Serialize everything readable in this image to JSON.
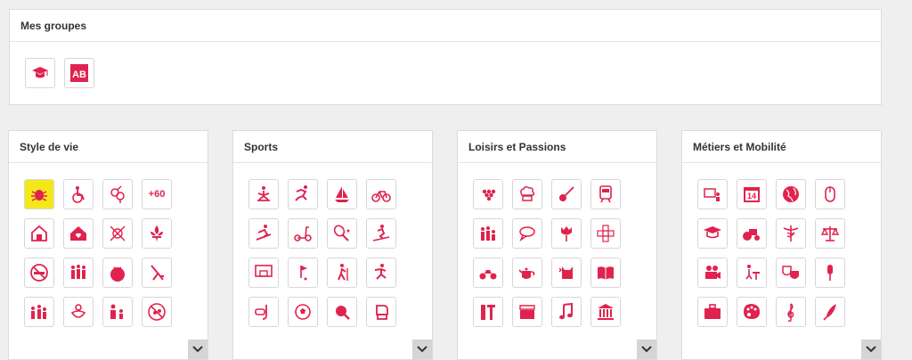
{
  "groups": {
    "title": "Mes groupes",
    "icons": [
      "graduation-cap-icon",
      "ab-letters-icon"
    ]
  },
  "categories": [
    {
      "title": "Style de vie",
      "icons": [
        "bug-icon",
        "wheelchair-icon",
        "gender-symbols-icon",
        "plus-60-icon",
        "house-icon",
        "house-heart-icon",
        "no-gender-icon",
        "fleur-de-lis-icon",
        "no-smoking-icon",
        "family-group-icon",
        "tomato-icon",
        "deck-chair-icon",
        "family-icon",
        "baby-pacifier-icon",
        "parent-child-icon",
        "no-pets-icon"
      ],
      "labels": {
        "plus-60-icon": "+60"
      }
    },
    {
      "title": "Sports",
      "icons": [
        "yoga-icon",
        "running-icon",
        "sailboat-icon",
        "bicycle-icon",
        "snowboard-icon",
        "scooter-icon",
        "tennis-icon",
        "ski-icon",
        "basketball-icon",
        "golf-icon",
        "hiking-icon",
        "ice-skating-icon",
        "snorkel-icon",
        "soccer-ball-icon",
        "ping-pong-icon",
        "boxing-glove-icon"
      ]
    },
    {
      "title": "Loisirs et Passions",
      "icons": [
        "grapes-icon",
        "chef-hat-icon",
        "guitar-icon",
        "train-icon",
        "family-walk-icon",
        "speech-bubble-icon",
        "tulip-icon",
        "crossword-icon",
        "motorcycle-icon",
        "teapot-icon",
        "cat-heart-icon",
        "open-book-icon",
        "tools-icon",
        "clapperboard-icon",
        "music-note-icon",
        "museum-icon"
      ]
    },
    {
      "title": "Métiers et Mobilité",
      "icons": [
        "presentation-icon",
        "calendar-14-icon",
        "globe-icon",
        "mouse-icon",
        "graduation-icon",
        "tractor-icon",
        "caduceus-icon",
        "scales-icon",
        "video-camera-icon",
        "teacher-desk-icon",
        "theater-masks-icon",
        "microphone-icon",
        "briefcase-icon",
        "palette-icon",
        "treble-clef-icon",
        "quill-icon"
      ],
      "labels": {
        "calendar-14-icon": "14"
      }
    }
  ],
  "colors": {
    "accent": "#e0234e",
    "selected_bg": "#f5e81a"
  }
}
